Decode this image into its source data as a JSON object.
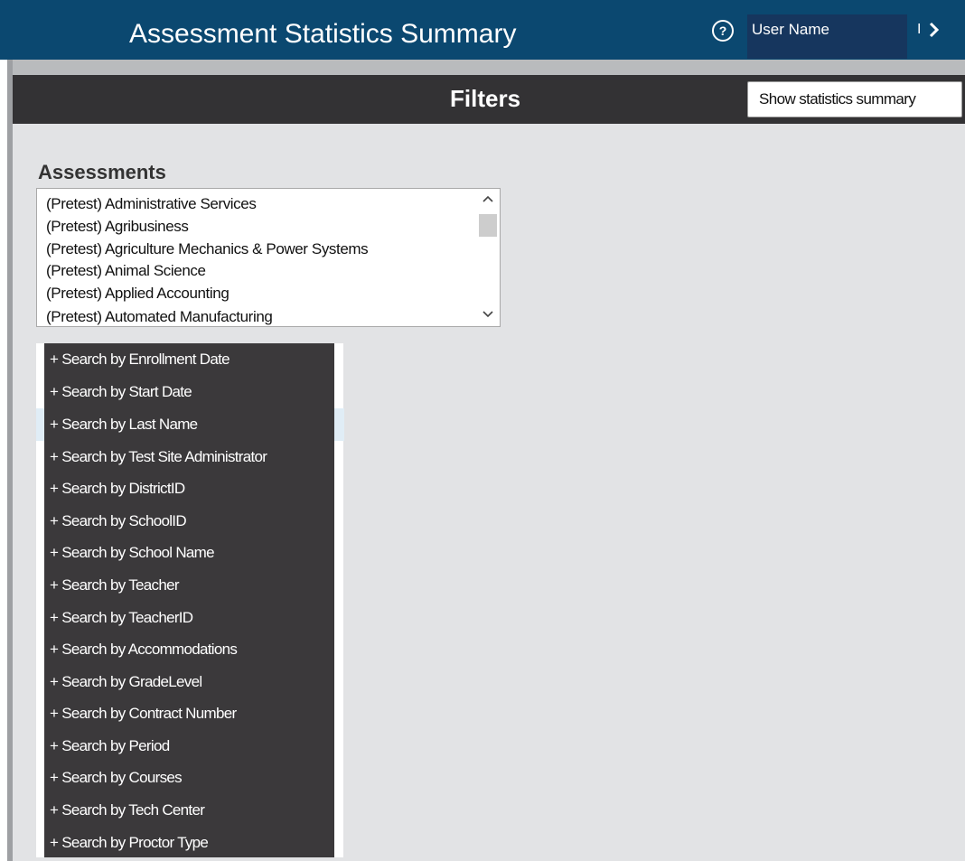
{
  "header": {
    "title": "Assessment Statistics Summary",
    "help_icon_glyph": "?",
    "user_name": "User Name",
    "separator": "I",
    "background": "#0b4870"
  },
  "filters": {
    "title": "Filters",
    "show_button_label": "Show statistics summary"
  },
  "assessments": {
    "label": "Assessments",
    "options": [
      "(Pretest) Administrative Services",
      "(Pretest) Agribusiness",
      "(Pretest) Agriculture Mechanics & Power Systems",
      "(Pretest) Animal Science",
      "(Pretest) Applied Accounting",
      "(Pretest) Automated Manufacturing"
    ]
  },
  "search_filters": [
    "+ Search by Enrollment Date",
    "+ Search by Start Date",
    "+ Search by Last Name",
    "+ Search by Test Site Administrator",
    "+ Search by DistrictID",
    "+ Search by SchoolID",
    "+ Search by School Name",
    "+ Search by Teacher",
    "+ Search by TeacherID",
    "+ Search by Accommodations",
    "+ Search by GradeLevel",
    "+ Search by Contract Number",
    "+ Search by Period",
    "+ Search by Courses",
    "+ Search by Tech Center",
    "+ Search by Proctor Type"
  ],
  "icons": {
    "help": "help-icon",
    "next": "chevron-right-icon",
    "scroll_up": "arrow-up-icon",
    "scroll_down": "arrow-down-icon"
  }
}
